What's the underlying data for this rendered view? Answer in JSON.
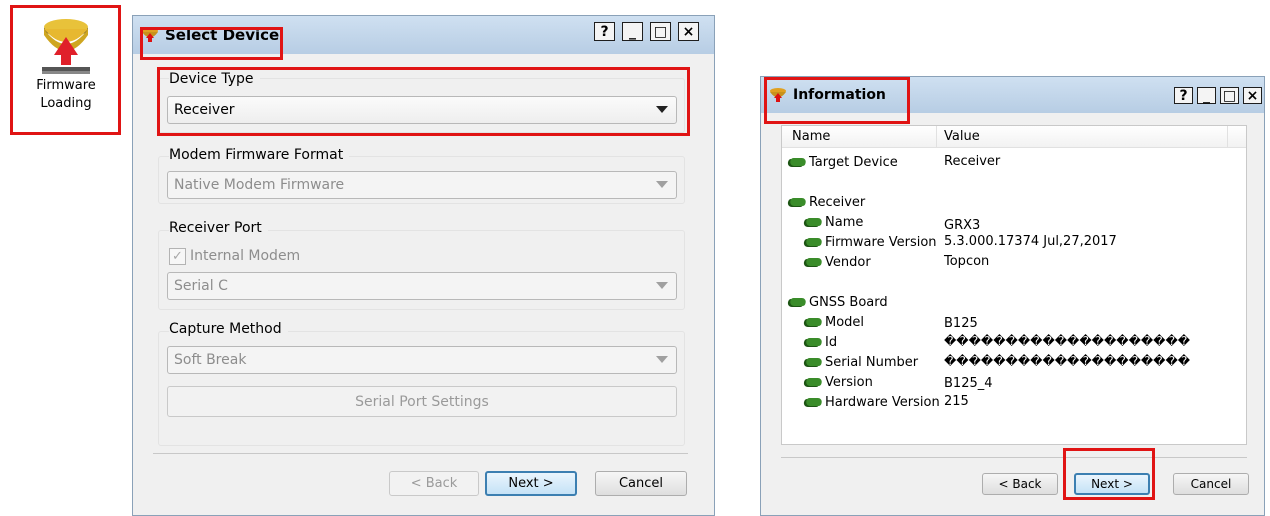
{
  "desktop": {
    "icon_label_line1": "Firmware",
    "icon_label_line2": "Loading"
  },
  "select_device": {
    "title": "Select Device",
    "caption_help": "?",
    "caption_min": "_",
    "caption_max": "□",
    "caption_close": "×",
    "device_type": {
      "label": "Device Type",
      "value": "Receiver"
    },
    "modem_fw": {
      "label": "Modem Firmware Format",
      "value": "Native Modem Firmware"
    },
    "receiver_port": {
      "label": "Receiver Port",
      "checkbox_label": "Internal Modem",
      "value": "Serial C"
    },
    "capture": {
      "label": "Capture Method",
      "value": "Soft Break",
      "settings_button": "Serial Port Settings"
    },
    "buttons": {
      "back": "< Back",
      "next": "Next >",
      "cancel": "Cancel"
    }
  },
  "information": {
    "title": "Information",
    "caption_help": "?",
    "caption_min": "_",
    "caption_max": "□",
    "caption_close": "×",
    "columns": {
      "name": "Name",
      "value": "Value"
    },
    "rows": {
      "target_device": {
        "name": "Target Device",
        "value": "Receiver"
      },
      "receiver": {
        "name": "Receiver"
      },
      "rx_name": {
        "name": "Name",
        "value": "GRX3"
      },
      "rx_fw": {
        "name": "Firmware Version",
        "value": "5.3.000.17374 Jul,27,2017"
      },
      "rx_vendor": {
        "name": "Vendor",
        "value": "Topcon"
      },
      "gnss": {
        "name": "GNSS Board"
      },
      "model": {
        "name": "Model",
        "value": "B125"
      },
      "id": {
        "name": "Id",
        "value": "��������������������"
      },
      "serial": {
        "name": "Serial Number",
        "value": "��������������������"
      },
      "version": {
        "name": "Version",
        "value": "B125_4"
      },
      "hw": {
        "name": "Hardware Version",
        "value": "215"
      }
    },
    "buttons": {
      "back": "< Back",
      "next": "Next >",
      "cancel": "Cancel"
    }
  }
}
